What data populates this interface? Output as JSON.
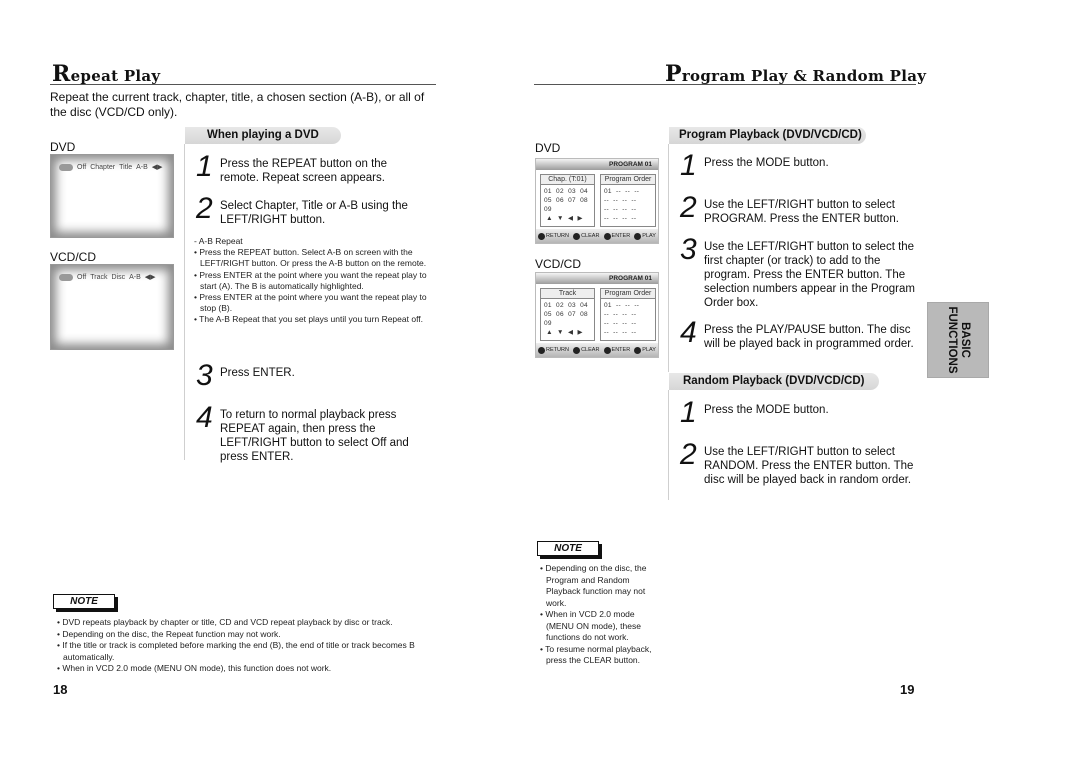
{
  "left_page": {
    "title_cap": "R",
    "title_rest": "epeat Play",
    "intro": "Repeat the current track, chapter, title, a chosen section (A-B), or all of the disc (VCD/CD only).",
    "dvd_label": "DVD",
    "vcd_label": "VCD/CD",
    "dvd_screen": {
      "items": [
        "Off",
        "Chapter",
        "Title",
        "A-B"
      ],
      "arrows": "◀▶"
    },
    "vcd_screen": {
      "items": [
        "Off",
        "Track",
        "Disc",
        "A-B"
      ],
      "arrows": "◀▶"
    },
    "section_title": "When playing a DVD",
    "steps": [
      {
        "num": "1",
        "text": "Press the REPEAT button on the remote. Repeat screen appears."
      },
      {
        "num": "2",
        "text": "Select Chapter, Title or A-B using the LEFT/RIGHT button."
      },
      {
        "num": "3",
        "text": "Press ENTER."
      },
      {
        "num": "4",
        "text": "To return to normal playback press REPEAT again, then press the LEFT/RIGHT button to select Off and press ENTER."
      }
    ],
    "ab_heading": "-  A-B Repeat",
    "ab_bullets": [
      "• Press the REPEAT button. Select A-B on screen with the LEFT/RIGHT button. Or press the A-B button on the remote.",
      "• Press ENTER at the point where you want the repeat play to start (A). The B is automatically highlighted.",
      "• Press ENTER at the point where you want the repeat play to stop (B).",
      "• The A-B Repeat that you set plays until you turn Repeat off."
    ],
    "note_label": "NOTE",
    "notes": [
      "• DVD repeats playback by chapter or title, CD and VCD repeat playback by disc or track.",
      "• Depending on the disc, the Repeat function may not work.",
      "• If the title or track is completed before marking the end (B), the end of title or track becomes B automatically.",
      "• When in VCD 2.0 mode (MENU ON mode), this function does not work."
    ],
    "page_number": "18"
  },
  "right_page": {
    "title_cap": "P",
    "title_rest": "rogram Play & Random Play",
    "dvd_label": "DVD",
    "vcd_label": "VCD/CD",
    "dvd_program_screen": {
      "header": "PROGRAM  01",
      "left_header": "Chap. (T:01)",
      "left_grid": "01  02  03  04\n05  06  07  08\n09\n ▲  ▼  ◀  ▶",
      "right_header": "Program Order",
      "right_grid": "01  --  --  --\n--  --  --  --\n--  --  --  --\n--  --  --  --",
      "footer": [
        "RETURN",
        "CLEAR",
        "ENTER",
        "PLAY"
      ]
    },
    "vcd_program_screen": {
      "header": "PROGRAM  01",
      "left_header": "Track",
      "left_grid": "01  02  03  04\n05  06  07  08\n09\n ▲  ▼  ◀  ▶",
      "right_header": "Program Order",
      "right_grid": "01  --  --  --\n--  --  --  --\n--  --  --  --\n--  --  --  --",
      "footer": [
        "RETURN",
        "CLEAR",
        "ENTER",
        "PLAY"
      ]
    },
    "program_section_title": "Program Playback (DVD/VCD/CD)",
    "program_steps": [
      {
        "num": "1",
        "text": "Press the MODE button."
      },
      {
        "num": "2",
        "text": "Use the LEFT/RIGHT button to select PROGRAM. Press the ENTER button."
      },
      {
        "num": "3",
        "text": "Use the LEFT/RIGHT button to select the first chapter (or track) to add to the program. Press the ENTER button. The selection numbers appear in the Program Order box."
      },
      {
        "num": "4",
        "text": "Press the PLAY/PAUSE button. The disc will be played back in programmed order."
      }
    ],
    "random_section_title": "Random Playback (DVD/VCD/CD)",
    "random_steps": [
      {
        "num": "1",
        "text": "Press the MODE button."
      },
      {
        "num": "2",
        "text": "Use the LEFT/RIGHT button to select RANDOM. Press the ENTER button. The disc will be played back in random order."
      }
    ],
    "note_label": "NOTE",
    "notes": [
      "• Depending on the disc, the Program and Random Playback function may not work.",
      "• When in VCD 2.0 mode (MENU ON mode), these functions do not work.",
      "• To resume normal playback, press the CLEAR button."
    ],
    "side_tab": {
      "line1": "BASIC",
      "line2": "FUNCTIONS"
    },
    "page_number": "19"
  }
}
